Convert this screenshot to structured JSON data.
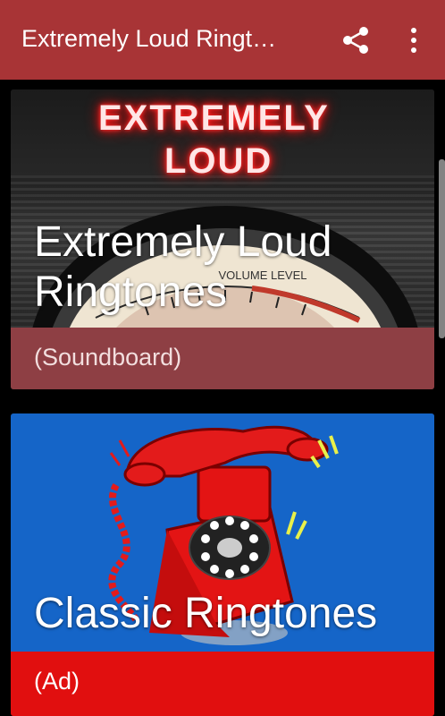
{
  "appbar": {
    "title": "Extremely Loud Ringt…",
    "icons": [
      "share-icon",
      "more-vert-icon"
    ],
    "color": "#A83436"
  },
  "cards": [
    {
      "image_text_line1": "EXTREMELY",
      "image_text_line2": "LOUD",
      "image_gauge_label": "VOLUME LEVEL",
      "title": "Extremely Loud Ringtones",
      "subtitle": "(Soundboard)",
      "footer_color": "#8E3F44"
    },
    {
      "title": "Classic Ringtones",
      "subtitle": "(Ad)",
      "footer_color": "#E10F0F",
      "image_background": "#1565C8"
    }
  ]
}
